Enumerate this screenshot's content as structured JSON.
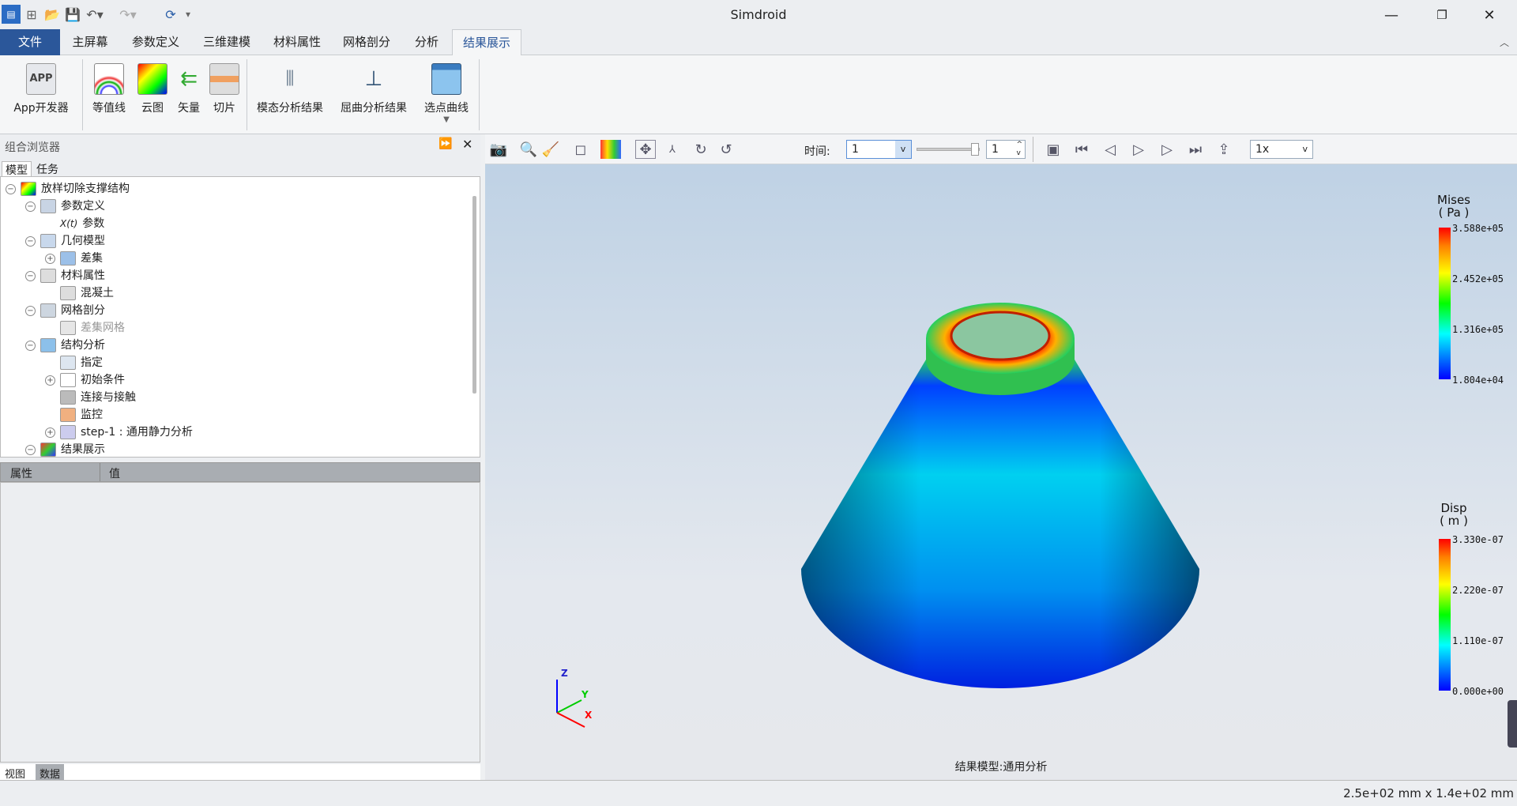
{
  "window": {
    "title": "Simdroid"
  },
  "quick_access": [
    "app-icon",
    "new-icon",
    "open-icon",
    "save-icon",
    "undo-icon",
    "redo-icon",
    "refresh-icon"
  ],
  "tabs": [
    {
      "label": "文件"
    },
    {
      "label": "主屏幕"
    },
    {
      "label": "参数定义"
    },
    {
      "label": "三维建模"
    },
    {
      "label": "材料属性"
    },
    {
      "label": "网格剖分"
    },
    {
      "label": "分析"
    },
    {
      "label": "结果展示",
      "active": true
    }
  ],
  "ribbon": {
    "items": [
      {
        "label": "App开发器"
      },
      {
        "label": "等值线"
      },
      {
        "label": "云图"
      },
      {
        "label": "矢量"
      },
      {
        "label": "切片"
      },
      {
        "label": "模态分析结果"
      },
      {
        "label": "屈曲分析结果"
      },
      {
        "label": "选点曲线"
      }
    ],
    "app_icon_text": "APP"
  },
  "browser": {
    "title": "组合浏览器",
    "tabs": [
      "模型",
      "任务"
    ],
    "tree": [
      {
        "label": "放样切除支撑结构",
        "level": 0,
        "toggle": "−"
      },
      {
        "label": "参数定义",
        "level": 1,
        "toggle": "−"
      },
      {
        "label": "参数",
        "level": 2,
        "prefix": "X(t)"
      },
      {
        "label": "几何模型",
        "level": 1,
        "toggle": "−"
      },
      {
        "label": "差集",
        "level": 2,
        "toggle": "+"
      },
      {
        "label": "材料属性",
        "level": 1,
        "toggle": "−"
      },
      {
        "label": "混凝土",
        "level": 2
      },
      {
        "label": "网格剖分",
        "level": 1,
        "toggle": "−"
      },
      {
        "label": "差集网格",
        "level": 2,
        "disabled": true
      },
      {
        "label": "结构分析",
        "level": 1,
        "toggle": "−"
      },
      {
        "label": "指定",
        "level": 2
      },
      {
        "label": "初始条件",
        "level": 2,
        "toggle": "+"
      },
      {
        "label": "连接与接触",
        "level": 2
      },
      {
        "label": "监控",
        "level": 2
      },
      {
        "label": "step-1 : 通用静力分析",
        "level": 2,
        "toggle": "+"
      },
      {
        "label": "结果展示",
        "level": 1,
        "toggle": "−"
      }
    ]
  },
  "properties": {
    "col_property": "属性",
    "col_value": "值"
  },
  "bottom_tabs": [
    "视图",
    "数据"
  ],
  "viewer_toolbar": {
    "time_label": "时间:",
    "time_value": "1",
    "step_value": "1",
    "speed": "1x",
    "slider_fraction": 1.0
  },
  "legends": [
    {
      "title": "Mises",
      "unit": "( Pa )",
      "values": [
        "3.588e+05",
        "2.452e+05",
        "1.316e+05",
        "1.804e+04"
      ]
    },
    {
      "title": "Disp",
      "unit": "( m )",
      "values": [
        "3.330e-07",
        "2.220e-07",
        "1.110e-07",
        "0.000e+00"
      ]
    }
  ],
  "axes": {
    "x": "X",
    "y": "Y",
    "z": "Z"
  },
  "viewport_caption": "结果模型:通用分析",
  "status": {
    "dimensions": "2.5e+02 mm x 1.4e+02 mm"
  },
  "colors": {
    "accent": "#2b579a",
    "legend_max": "#ff0000",
    "legend_min": "#0000ff"
  }
}
